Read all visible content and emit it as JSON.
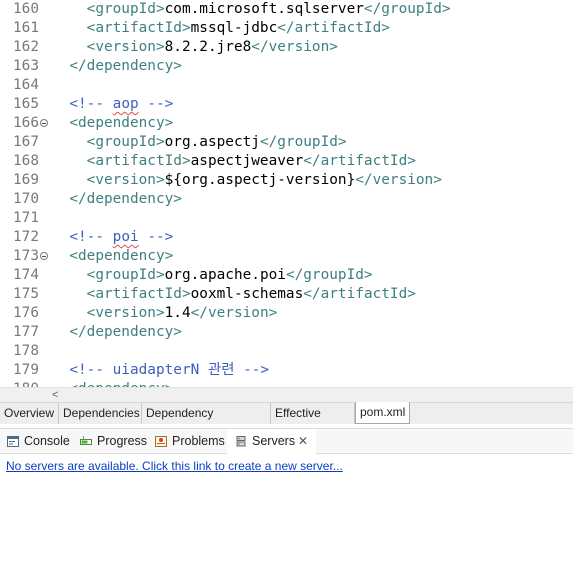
{
  "editor": {
    "lines": [
      {
        "n": "160",
        "indent": "    ",
        "parts": [
          [
            "tag",
            "<groupId>"
          ],
          [
            "txt",
            "com.microsoft.sqlserver"
          ],
          [
            "tag",
            "</groupId>"
          ]
        ]
      },
      {
        "n": "161",
        "indent": "    ",
        "parts": [
          [
            "tag",
            "<artifactId>"
          ],
          [
            "txt",
            "mssql-jdbc"
          ],
          [
            "tag",
            "</artifactId>"
          ]
        ]
      },
      {
        "n": "162",
        "indent": "    ",
        "parts": [
          [
            "tag",
            "<version>"
          ],
          [
            "txt",
            "8.2.2.jre8"
          ],
          [
            "tag",
            "</version>"
          ]
        ]
      },
      {
        "n": "163",
        "indent": "  ",
        "parts": [
          [
            "tag",
            "</dependency>"
          ]
        ]
      },
      {
        "n": "164",
        "indent": "",
        "parts": []
      },
      {
        "n": "165",
        "indent": "  ",
        "parts": [
          [
            "cmt",
            "<!-- "
          ],
          [
            "cmt-squig",
            "aop"
          ],
          [
            "cmt",
            " -->"
          ]
        ]
      },
      {
        "n": "166",
        "fold": true,
        "indent": "  ",
        "parts": [
          [
            "tag",
            "<dependency>"
          ]
        ]
      },
      {
        "n": "167",
        "indent": "    ",
        "parts": [
          [
            "tag",
            "<groupId>"
          ],
          [
            "txt",
            "org.aspectj"
          ],
          [
            "tag",
            "</groupId>"
          ]
        ]
      },
      {
        "n": "168",
        "indent": "    ",
        "parts": [
          [
            "tag",
            "<artifactId>"
          ],
          [
            "txt",
            "aspectjweaver"
          ],
          [
            "tag",
            "</artifactId>"
          ]
        ]
      },
      {
        "n": "169",
        "indent": "    ",
        "parts": [
          [
            "tag",
            "<version>"
          ],
          [
            "txt",
            "${org.aspectj-version}"
          ],
          [
            "tag",
            "</version>"
          ]
        ]
      },
      {
        "n": "170",
        "indent": "  ",
        "parts": [
          [
            "tag",
            "</dependency>"
          ]
        ]
      },
      {
        "n": "171",
        "indent": "",
        "parts": []
      },
      {
        "n": "172",
        "indent": "  ",
        "parts": [
          [
            "cmt",
            "<!-- "
          ],
          [
            "cmt-squig",
            "poi"
          ],
          [
            "cmt",
            " -->"
          ]
        ]
      },
      {
        "n": "173",
        "fold": true,
        "indent": "  ",
        "parts": [
          [
            "tag",
            "<dependency>"
          ]
        ]
      },
      {
        "n": "174",
        "indent": "    ",
        "parts": [
          [
            "tag",
            "<groupId>"
          ],
          [
            "txt",
            "org.apache.poi"
          ],
          [
            "tag",
            "</groupId>"
          ]
        ]
      },
      {
        "n": "175",
        "indent": "    ",
        "parts": [
          [
            "tag",
            "<artifactId>"
          ],
          [
            "txt",
            "ooxml-schemas"
          ],
          [
            "tag",
            "</artifactId>"
          ]
        ]
      },
      {
        "n": "176",
        "indent": "    ",
        "parts": [
          [
            "tag",
            "<version>"
          ],
          [
            "txt",
            "1.4"
          ],
          [
            "tag",
            "</version>"
          ]
        ]
      },
      {
        "n": "177",
        "indent": "  ",
        "parts": [
          [
            "tag",
            "</dependency>"
          ]
        ]
      },
      {
        "n": "178",
        "indent": "",
        "parts": []
      },
      {
        "n": "179",
        "indent": "  ",
        "parts": [
          [
            "cmt",
            "<!-- uiadapterN 관련 -->"
          ]
        ]
      },
      {
        "n": "180",
        "indent": "  ",
        "parts": [
          [
            "tag",
            "<dependency>"
          ]
        ]
      }
    ],
    "colors": {
      "tag": "#3f7f7f",
      "text": "#000000",
      "comment": "#3f5fbf",
      "line_number": "#787878"
    }
  },
  "scrollbar": {
    "left_arrow": "<"
  },
  "editor_tabs": [
    {
      "label": "Overview",
      "active": false
    },
    {
      "label": "Dependencies",
      "active": false
    },
    {
      "label": "Dependency Hierarchy",
      "active": false
    },
    {
      "label": "Effective POM",
      "active": false
    },
    {
      "label": "pom.xml",
      "active": true
    }
  ],
  "view_tabs": [
    {
      "label": "Console",
      "icon": "console-icon",
      "active": false
    },
    {
      "label": "Progress",
      "icon": "progress-icon",
      "active": false
    },
    {
      "label": "Problems",
      "icon": "problems-icon",
      "active": false
    },
    {
      "label": "Servers",
      "icon": "servers-icon",
      "active": true,
      "close": "✕"
    }
  ],
  "servers_view": {
    "link_text": "No servers are available. Click this link to create a new server...",
    "link_color": "#0b3fbf"
  }
}
